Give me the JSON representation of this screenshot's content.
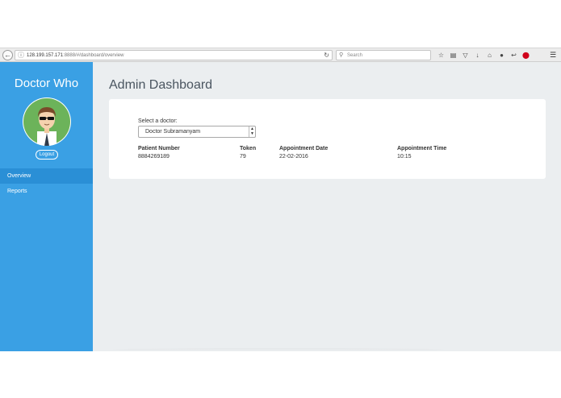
{
  "browser": {
    "url_host": "128.199.157.171",
    "url_path": ":8888/#/dashboard/overview",
    "search_placeholder": "Search",
    "icons": [
      "star-icon",
      "clipboard-icon",
      "pocket-icon",
      "download-icon",
      "home-icon",
      "chat-icon",
      "reply-icon",
      "adblock-icon",
      "menu-icon"
    ]
  },
  "sidebar": {
    "brand": "Doctor Who",
    "logout_label": "Logout",
    "items": [
      {
        "label": "Overview",
        "active": true
      },
      {
        "label": "Reports",
        "active": false
      }
    ],
    "accent_color": "#3aa0e4",
    "active_color": "#2a8fd6"
  },
  "main": {
    "title": "Admin Dashboard",
    "select_label": "Select a doctor:",
    "selected_doctor": "Doctor Subramanyam",
    "table": {
      "headers": [
        "Patient Number",
        "Token",
        "Appointment Date",
        "Appointment Time"
      ],
      "rows": [
        [
          "8884269189",
          "79",
          "22-02-2016",
          "10:15"
        ]
      ]
    }
  }
}
